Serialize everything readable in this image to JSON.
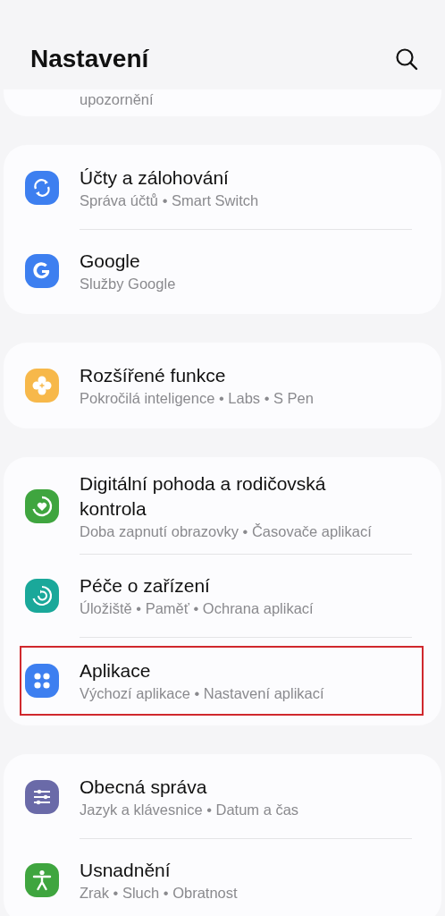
{
  "header": {
    "title": "Nastavení"
  },
  "partial_item": {
    "subtitle": "upozornění"
  },
  "groups": [
    {
      "items": [
        {
          "kind": "sync",
          "color": "#3d7ff0",
          "title": "Účty a zálohování",
          "subtitle": "Správa účtů • Smart Switch",
          "highlighted": false
        },
        {
          "kind": "google",
          "color": "#3d7ff0",
          "title": "Google",
          "subtitle": "Služby Google",
          "highlighted": false
        }
      ]
    },
    {
      "items": [
        {
          "kind": "flower",
          "color": "#f7b84a",
          "title": "Rozšířené funkce",
          "subtitle": "Pokročilá inteligence • Labs • S Pen",
          "highlighted": false
        }
      ]
    },
    {
      "items": [
        {
          "kind": "wellbeing",
          "color": "#3fa53f",
          "title": "Digitální pohoda a rodičovská kontrola",
          "subtitle": "Doba zapnutí obrazovky • Časovače aplikací",
          "highlighted": false
        },
        {
          "kind": "care",
          "color": "#1aa89a",
          "title": "Péče o zařízení",
          "subtitle": "Úložiště • Paměť • Ochrana aplikací",
          "highlighted": false
        },
        {
          "kind": "apps",
          "color": "#3d7ff0",
          "title": "Aplikace",
          "subtitle": "Výchozí aplikace • Nastavení aplikací",
          "highlighted": true
        }
      ]
    },
    {
      "items": [
        {
          "kind": "sliders",
          "color": "#6a6aa8",
          "title": "Obecná správa",
          "subtitle": "Jazyk a klávesnice • Datum a čas",
          "highlighted": false
        },
        {
          "kind": "accessibility",
          "color": "#3fa53f",
          "title": "Usnadnění",
          "subtitle": "Zrak • Sluch • Obratnost",
          "highlighted": false
        }
      ]
    }
  ]
}
